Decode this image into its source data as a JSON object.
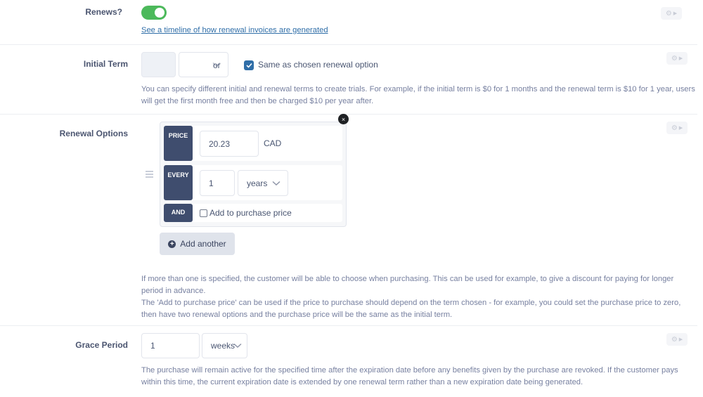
{
  "renews": {
    "label": "Renews?",
    "enabled": true,
    "timeline_link": "See a timeline of how renewal invoices are generated"
  },
  "initial_term": {
    "label": "Initial Term",
    "amount_value": "",
    "unit_value": "",
    "or_text": "or",
    "same_as_renewal_checked": true,
    "same_as_renewal_label": "Same as chosen renewal option",
    "help": "You can specify different initial and renewal terms to create trials. For example, if the initial term is $0 for 1 months and the renewal term is $10 for 1 year, users will get the first month free and then be charged $10 per year after."
  },
  "renewal_options": {
    "label": "Renewal Options",
    "options": [
      {
        "price_tag": "PRICE",
        "price_value": "20.23",
        "currency": "CAD",
        "every_tag": "EVERY",
        "interval_value": "1",
        "interval_unit": "years",
        "and_tag": "AND",
        "add_to_purchase_checked": false,
        "add_to_purchase_label": "Add to purchase price"
      }
    ],
    "remove_icon": "×",
    "add_another_label": "Add another",
    "help_line1": "If more than one is specified, the customer will be able to choose when purchasing. This can be used for example, to give a discount for paying for longer period in advance.",
    "help_line2": "The 'Add to purchase price' can be used if the price to purchase should depend on the term chosen - for example, you could set the purchase price to zero, then have two renewal options and the purchase price will be the same as the initial term."
  },
  "grace_period": {
    "label": "Grace Period",
    "amount_value": "1",
    "unit_value": "weeks",
    "help": "The purchase will remain active for the specified time after the expiration date before any benefits given by the purchase are revoked. If the customer pays within this time, the current expiration date is extended by one renewal term rather than a new expiration date being generated."
  },
  "icons": {
    "gear": "⚙",
    "caret": "▶"
  },
  "colors": {
    "toggle_on": "#4cb95b",
    "tag_bg": "#3f4d6e",
    "link": "#2f6ea8",
    "checkbox": "#2f6ea8"
  }
}
